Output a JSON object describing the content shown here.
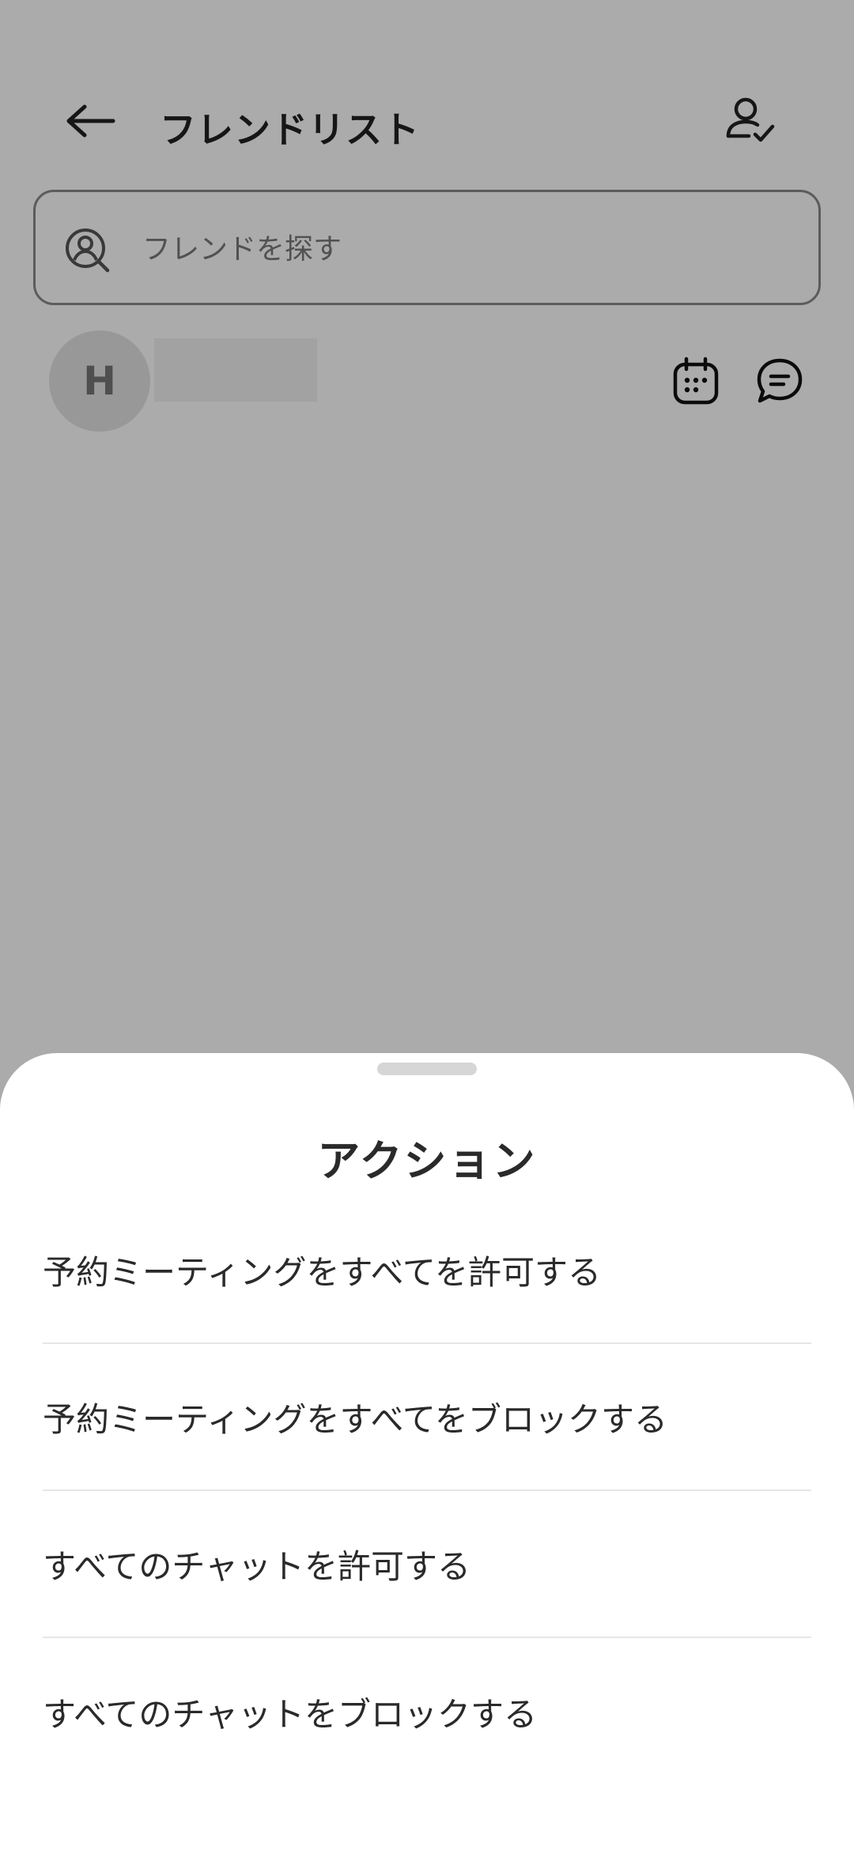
{
  "header": {
    "title": "フレンドリスト",
    "back_icon": "arrow-left-icon",
    "friend_request_icon": "user-check-icon"
  },
  "search": {
    "placeholder": "フレンドを探す",
    "value": "",
    "icon": "user-search-icon"
  },
  "friends": [
    {
      "avatar_initial": "H",
      "calendar_icon": "calendar-icon",
      "chat_icon": "chat-icon"
    }
  ],
  "sheet": {
    "title": "アクション",
    "actions": [
      {
        "label": "予約ミーティングをすべてを許可する"
      },
      {
        "label": "予約ミーティングをすべてをブロックする"
      },
      {
        "label": "すべてのチャットを許可する"
      },
      {
        "label": "すべてのチャットをブロックする"
      }
    ]
  },
  "colors": {
    "scrim": "#000000",
    "text": "#2a2a2a",
    "divider": "#e6e6e6"
  }
}
